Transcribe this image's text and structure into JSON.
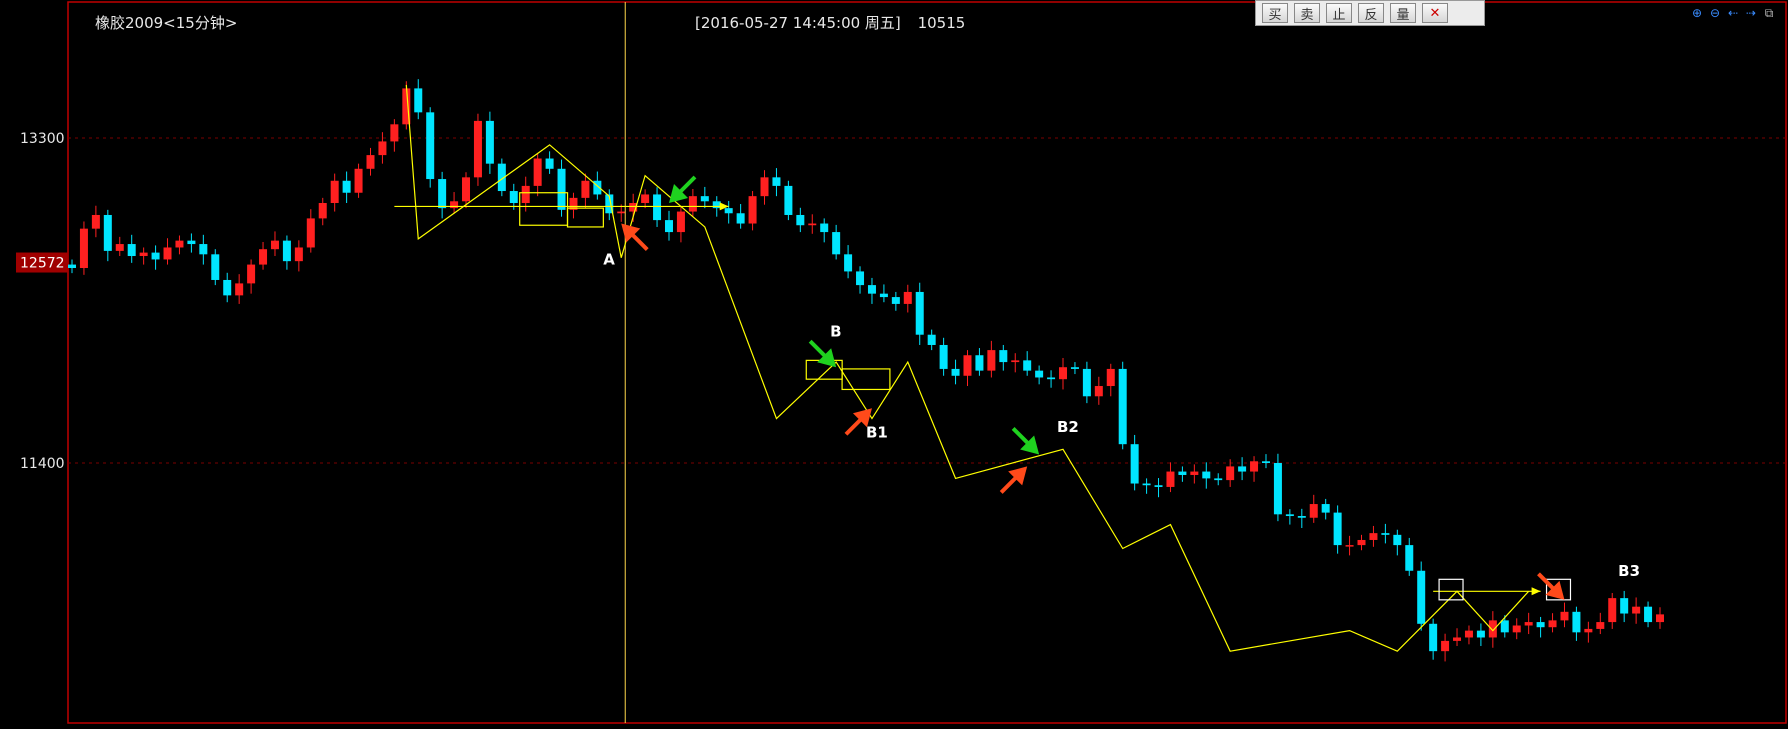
{
  "header": {
    "title": "橡胶2009<15分钟>",
    "cursor_datetime": "[2016-05-27  14:45:00 周五]",
    "cursor_value": "10515"
  },
  "toolbar": {
    "buttons": [
      "买",
      "卖",
      "止",
      "反",
      "量",
      "✕"
    ]
  },
  "zoom_tools": [
    "zoom-in-icon",
    "zoom-out-icon",
    "scroll-left-icon",
    "scroll-right-icon",
    "restore-icon"
  ],
  "colors": {
    "background": "#000000",
    "frame": "#c00000",
    "up_candle": "#ff2020",
    "down_candle": "#00e5ff",
    "trend_line": "#ffff00",
    "arrow_red": "#ff4a1a",
    "arrow_green": "#1fd21f",
    "grid": "#7a0000",
    "price_badge": "#a00000"
  },
  "chart_data": {
    "type": "candlestick",
    "y_axis": {
      "ticks": [
        13300,
        11400
      ],
      "current_price_label": "12572",
      "ylim": [
        10100,
        13650
      ]
    },
    "grid": "dashed horizontal",
    "price_series": [
      12540,
      12770,
      12850,
      12640,
      12680,
      12610,
      12630,
      12590,
      12660,
      12700,
      12680,
      12620,
      12470,
      12380,
      12450,
      12560,
      12650,
      12700,
      12580,
      12660,
      12830,
      12920,
      13050,
      12980,
      13120,
      13200,
      13280,
      13380,
      13590,
      13450,
      13060,
      12890,
      12930,
      13070,
      13400,
      13150,
      12990,
      12920,
      13020,
      13180,
      13120,
      12880,
      12950,
      13050,
      12970,
      12860,
      12870,
      12920,
      12970,
      12820,
      12750,
      12870,
      12960,
      12930,
      12890,
      12860,
      12800,
      12960,
      13070,
      13020,
      12850,
      12790,
      12800,
      12750,
      12620,
      12520,
      12440,
      12390,
      12370,
      12330,
      12400,
      12150,
      12090,
      11950,
      11910,
      12030,
      11940,
      12060,
      11990,
      12000,
      11940,
      11900,
      11890,
      11960,
      11950,
      11790,
      11850,
      11950,
      11510,
      11280,
      11270,
      11260,
      11350,
      11330,
      11350,
      11310,
      11300,
      11380,
      11350,
      11410,
      11400,
      11100,
      11090,
      11080,
      11160,
      11110,
      10920,
      10920,
      10950,
      10990,
      10980,
      10920,
      10770,
      10460,
      10300,
      10360,
      10380,
      10420,
      10380,
      10480,
      10410,
      10450,
      10470,
      10440,
      10480,
      10530,
      10410,
      10430,
      10470,
      10610,
      10520,
      10560,
      10470,
      10515
    ],
    "annotations": {
      "labels": [
        {
          "text": "A",
          "x_index": 45,
          "value": 12560
        },
        {
          "text": "B",
          "x_index": 64,
          "value": 12140
        },
        {
          "text": "B1",
          "x_index": 67,
          "value": 11550
        },
        {
          "text": "B2",
          "x_index": 83,
          "value": 11580
        },
        {
          "text": "B3",
          "x_index": 130,
          "value": 10740
        }
      ],
      "zigzag": [
        {
          "i": 28,
          "v": 13610
        },
        {
          "i": 29,
          "v": 12710
        },
        {
          "i": 40,
          "v": 13260
        },
        {
          "i": 45,
          "v": 12960
        },
        {
          "i": 46,
          "v": 12600
        },
        {
          "i": 48,
          "v": 13080
        },
        {
          "i": 53,
          "v": 12780
        },
        {
          "i": 59,
          "v": 11660
        },
        {
          "i": 64,
          "v": 11990
        },
        {
          "i": 67,
          "v": 11660
        },
        {
          "i": 70,
          "v": 11990
        },
        {
          "i": 74,
          "v": 11310
        },
        {
          "i": 83,
          "v": 11480
        },
        {
          "i": 88,
          "v": 10900
        },
        {
          "i": 92,
          "v": 11040
        },
        {
          "i": 97,
          "v": 10300
        },
        {
          "i": 107,
          "v": 10420
        },
        {
          "i": 111,
          "v": 10300
        },
        {
          "i": 116,
          "v": 10650
        },
        {
          "i": 119,
          "v": 10420
        },
        {
          "i": 122,
          "v": 10650
        }
      ],
      "horizontal_lines": [
        {
          "from_index": 27,
          "to_index": 55,
          "value": 12900,
          "arrow": true
        },
        {
          "from_index": 114,
          "to_index": 123,
          "value": 10650,
          "arrow": true
        }
      ],
      "boxes": [
        {
          "from_index": 38,
          "to_index": 41,
          "top": 12980,
          "bottom": 12790
        },
        {
          "from_index": 42,
          "to_index": 44,
          "top": 12890,
          "bottom": 12780
        },
        {
          "from_index": 62,
          "to_index": 64,
          "top": 12000,
          "bottom": 11890
        },
        {
          "from_index": 65,
          "to_index": 68,
          "top": 11950,
          "bottom": 11830
        },
        {
          "from_index": 115,
          "to_index": 116,
          "top": 10720,
          "bottom": 10600
        },
        {
          "from_index": 124,
          "to_index": 125,
          "top": 10720,
          "bottom": 10600
        }
      ],
      "arrows": [
        {
          "color": "red",
          "x_index": 46,
          "value": 12800,
          "direction": "up-left"
        },
        {
          "color": "green",
          "x_index": 50,
          "value": 12920,
          "direction": "down-left"
        },
        {
          "color": "green",
          "x_index": 64,
          "value": 11960,
          "direction": "down-right"
        },
        {
          "color": "red",
          "x_index": 67,
          "value": 11720,
          "direction": "up-right"
        },
        {
          "color": "green",
          "x_index": 81,
          "value": 11450,
          "direction": "down-right"
        },
        {
          "color": "red",
          "x_index": 80,
          "value": 11380,
          "direction": "up-right"
        },
        {
          "color": "red",
          "x_index": 125,
          "value": 10600,
          "direction": "down-right"
        }
      ],
      "cursor_index": 46
    }
  }
}
